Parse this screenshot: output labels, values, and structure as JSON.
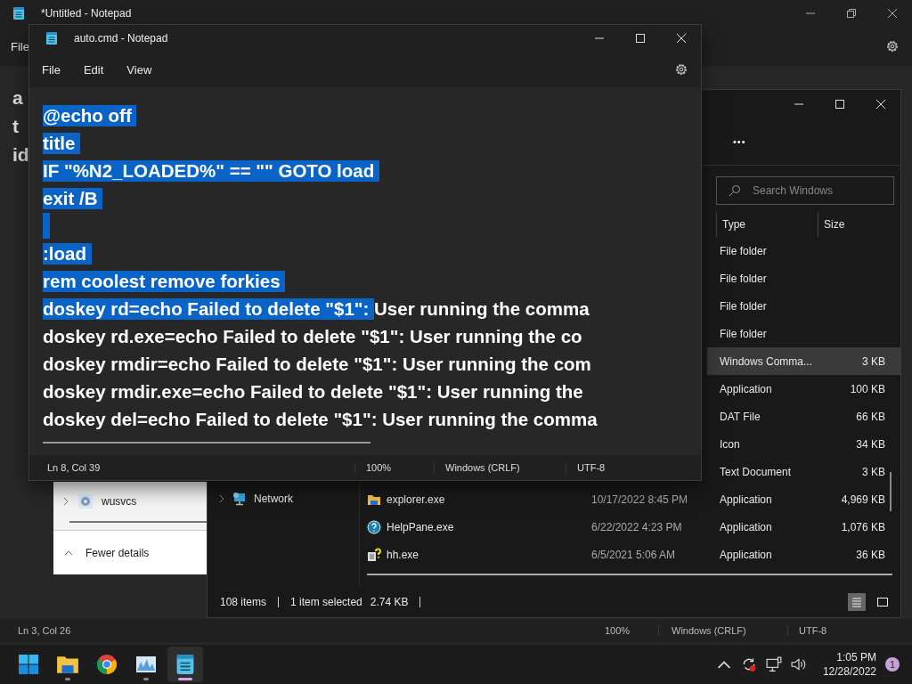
{
  "background_notepad": {
    "title": "*Untitled - Notepad",
    "menu": [
      "File"
    ],
    "text_lines": [
      "a",
      "t",
      "id"
    ],
    "status_bar": {
      "position": "Ln 3, Col 26",
      "zoom": "100%",
      "line_ending": "Windows (CRLF)",
      "encoding": "UTF-8"
    }
  },
  "task_manager": {
    "rows": [
      {
        "name": "wusvcs"
      }
    ],
    "footer": "Fewer details"
  },
  "explorer": {
    "search": {
      "placeholder": "Search Windows"
    },
    "more": "•••",
    "columns": [
      "Type",
      "Size"
    ],
    "nav": [
      {
        "label": "Network"
      }
    ],
    "rows": [
      {
        "type": "File folder",
        "selected": false
      },
      {
        "type": "File folder",
        "selected": false
      },
      {
        "type": "File folder",
        "selected": false
      },
      {
        "type": "File folder",
        "selected": false
      },
      {
        "type": "Windows Comma...",
        "size": "3 KB",
        "selected": true
      },
      {
        "type": "Application",
        "size": "100 KB",
        "selected": false
      },
      {
        "type": "DAT File",
        "size": "66 KB",
        "selected": false
      },
      {
        "type": "Icon",
        "size": "34 KB",
        "selected": false
      },
      {
        "type": "Text Document",
        "size": "3 KB",
        "selected": false
      },
      {
        "name": "explorer.exe",
        "kind": "folder",
        "date": "10/17/2022 8:45 PM",
        "type": "Application",
        "size": "4,969 KB",
        "selected": false
      },
      {
        "name": "HelpPane.exe",
        "kind": "help",
        "date": "6/22/2022 4:23 PM",
        "type": "Application",
        "size": "1,076 KB",
        "selected": false
      },
      {
        "name": "hh.exe",
        "kind": "helpdoc",
        "date": "6/5/2021 5:06 AM",
        "type": "Application",
        "size": "36 KB",
        "selected": false
      }
    ],
    "status": {
      "count": "108 items",
      "selection": "1 item selected",
      "size": "2.74 KB"
    },
    "views": [
      {
        "kind": "details",
        "selected": true
      },
      {
        "kind": "preview",
        "selected": false
      }
    ]
  },
  "notepad": {
    "title": "auto.cmd - Notepad",
    "menu": [
      "File",
      "Edit",
      "View"
    ],
    "lines": [
      {
        "segments": [
          {
            "text": "@echo off ",
            "selected": true
          }
        ]
      },
      {
        "segments": [
          {
            "text": "title ",
            "selected": true
          }
        ]
      },
      {
        "segments": [
          {
            "text": "IF \"%N2_LOADED%\" == \"\" GOTO load ",
            "selected": true
          }
        ]
      },
      {
        "segments": [
          {
            "text": "exit /B ",
            "selected": true
          }
        ]
      },
      {
        "eol_selected": true
      },
      {
        "segments": [
          {
            "text": ":load ",
            "selected": true
          }
        ]
      },
      {
        "segments": [
          {
            "text": "rem coolest remove forkies ",
            "selected": true
          }
        ]
      },
      {
        "segments": [
          {
            "text": "doskey rd=echo Failed to delete \"$1\": ",
            "selected": true
          },
          {
            "text": "User running the comma",
            "selected": false
          }
        ]
      },
      {
        "segments": [
          {
            "text": "doskey rd.exe=echo Failed to delete \"$1\": User running the co",
            "selected": false
          }
        ]
      },
      {
        "segments": [
          {
            "text": "doskey rmdir=echo Failed to delete \"$1\": User running the com",
            "selected": false
          }
        ]
      },
      {
        "segments": [
          {
            "text": "doskey rmdir.exe=echo Failed to delete \"$1\": User running the",
            "selected": false
          }
        ]
      },
      {
        "segments": [
          {
            "text": "doskey del=echo Failed to delete \"$1\": User running the comma",
            "selected": false
          }
        ]
      }
    ],
    "status_bar": {
      "position": "Ln 8, Col 39",
      "zoom": "100%",
      "line_ending": "Windows (CRLF)",
      "encoding": "UTF-8"
    }
  },
  "taskbar": {
    "apps": [
      {
        "kind": "start",
        "running": false,
        "selected": false
      },
      {
        "kind": "folder",
        "running": true,
        "selected": false
      },
      {
        "kind": "browser",
        "running": false,
        "selected": false
      },
      {
        "kind": "monitor",
        "running": true,
        "selected": false
      },
      {
        "kind": "notepad",
        "running": true,
        "selected": true
      }
    ],
    "time": "1:05 PM",
    "date": "12/28/2022",
    "notifications": "1"
  }
}
